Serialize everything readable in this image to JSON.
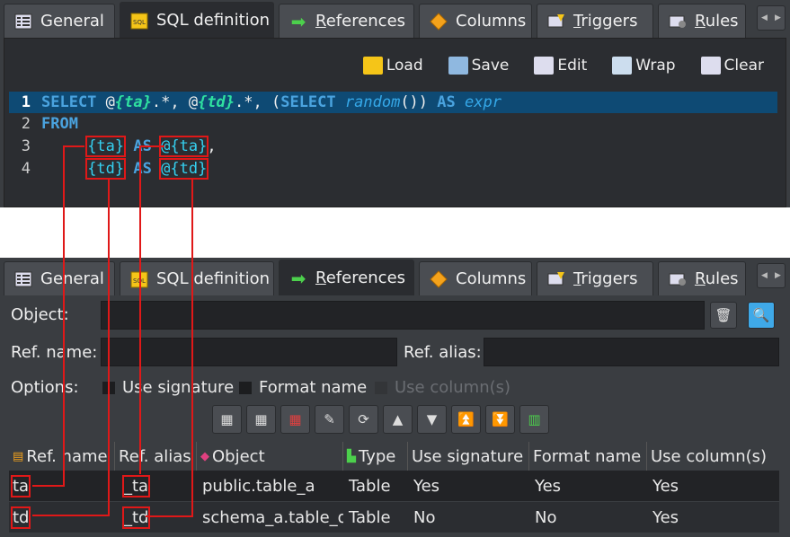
{
  "tabs": [
    {
      "label": "General",
      "icon": "general-icon",
      "u": ""
    },
    {
      "label": "SQL definition",
      "icon": "sql-icon",
      "u": ""
    },
    {
      "label": "eferences",
      "icon": "arrow-right-icon",
      "u": "R"
    },
    {
      "label": "Columns",
      "icon": "diamond-icon",
      "u": ""
    },
    {
      "label": "riggers",
      "icon": "triggers-icon",
      "u": "T"
    },
    {
      "label": "ules",
      "icon": "rules-icon",
      "u": "R"
    }
  ],
  "toolbar": {
    "load": "Load",
    "save": "Save",
    "edit": "Edit",
    "wrap": "Wrap",
    "clear": "Clear"
  },
  "sql": {
    "l1": "1",
    "l2": "2",
    "l3": "3",
    "l4": "4",
    "select": "SELECT",
    "at1": "@",
    "ta": "{ta}",
    "dotstar": ".*, ",
    "at2": "@",
    "td": "{td}",
    "dotstar2": ".*, (",
    "select2": "SELECT",
    "random": "random",
    "paren": "()) ",
    "as": "AS",
    "expr": "expr",
    "from": "FROM",
    "l3ref": "{ta}",
    "l3as": "AS",
    "l3alias": "@{ta}",
    "l3comma": ",",
    "l4ref": "{td}",
    "l4as": "AS",
    "l4alias": "@{td}"
  },
  "form": {
    "object_label": "Object:",
    "refname_label": "Ref. name:",
    "refalias_label": "Ref. alias:",
    "options_label": "Options:",
    "use_signature": "Use signature",
    "format_name": "Format name",
    "use_columns": "Use column(s)"
  },
  "grid": {
    "headers": [
      "Ref. name",
      "Ref. alias",
      "Object",
      "Type",
      "Use signature",
      "Format name",
      "Use column(s)"
    ],
    "rows": [
      [
        "ta",
        "_ta",
        "public.table_a",
        "Table",
        "Yes",
        "Yes",
        "Yes"
      ],
      [
        "td",
        "_td",
        "schema_a.table_d",
        "Table",
        "No",
        "No",
        "Yes"
      ]
    ]
  },
  "colors": {
    "accent": "#0e4a74",
    "highlight": "#e01818",
    "keyword": "#4aa3df"
  }
}
